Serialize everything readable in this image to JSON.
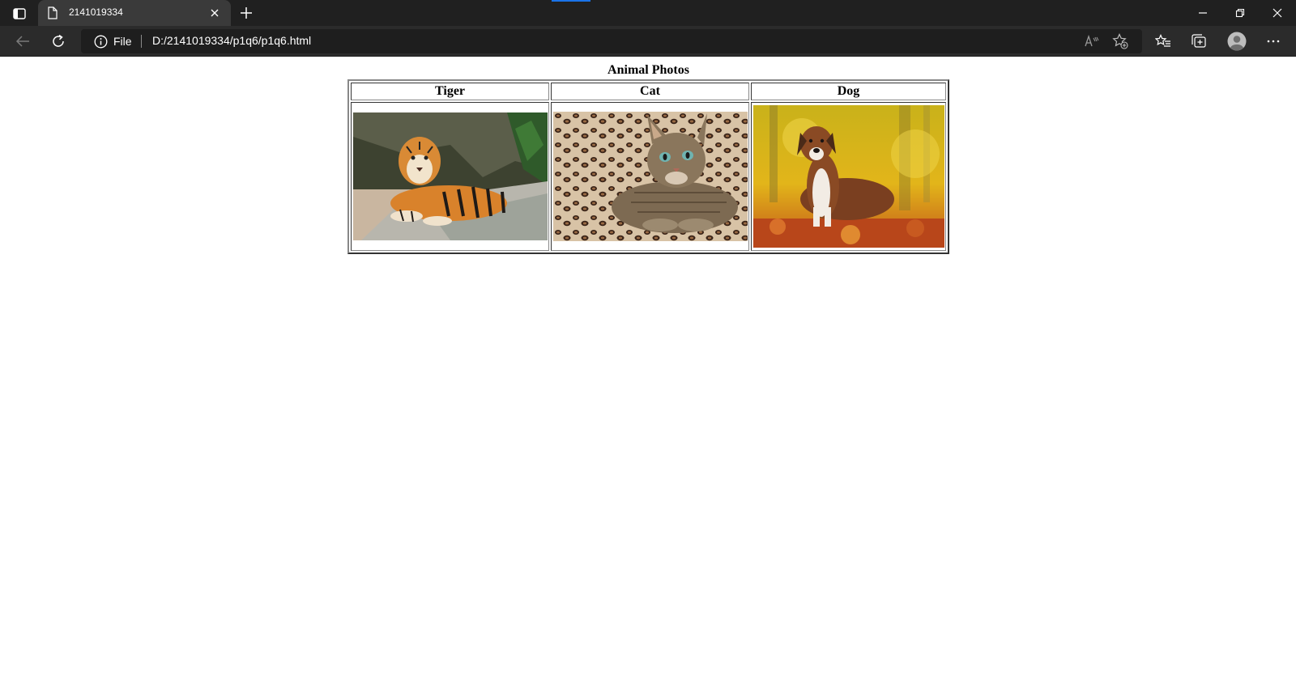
{
  "browser": {
    "tab_title": "2141019334",
    "site_info_label": "File",
    "url": "D:/2141019334/p1q6/p1q6.html",
    "accent_color": "#1a73e8",
    "chrome_color": "#202020",
    "toolbar_color": "#2b2b2b"
  },
  "icons": {
    "tab_actions": "tab-actions-icon",
    "favicon": "page-icon",
    "close_tab": "close-icon",
    "new_tab": "plus-icon",
    "minimize": "minimize-icon",
    "restore": "restore-icon",
    "close_window": "close-icon",
    "back": "back-arrow-icon",
    "reload": "reload-icon",
    "site_info": "info-icon",
    "read_aloud": "read-aloud-icon",
    "add_favorite": "star-plus-icon",
    "favorites": "favorites-icon",
    "collections": "collections-icon",
    "profile": "profile-icon",
    "more": "more-icon"
  },
  "page": {
    "caption": "Animal Photos",
    "columns": [
      "Tiger",
      "Cat",
      "Dog"
    ],
    "photos": [
      {
        "subject": "tiger"
      },
      {
        "subject": "cat"
      },
      {
        "subject": "dog"
      }
    ]
  }
}
